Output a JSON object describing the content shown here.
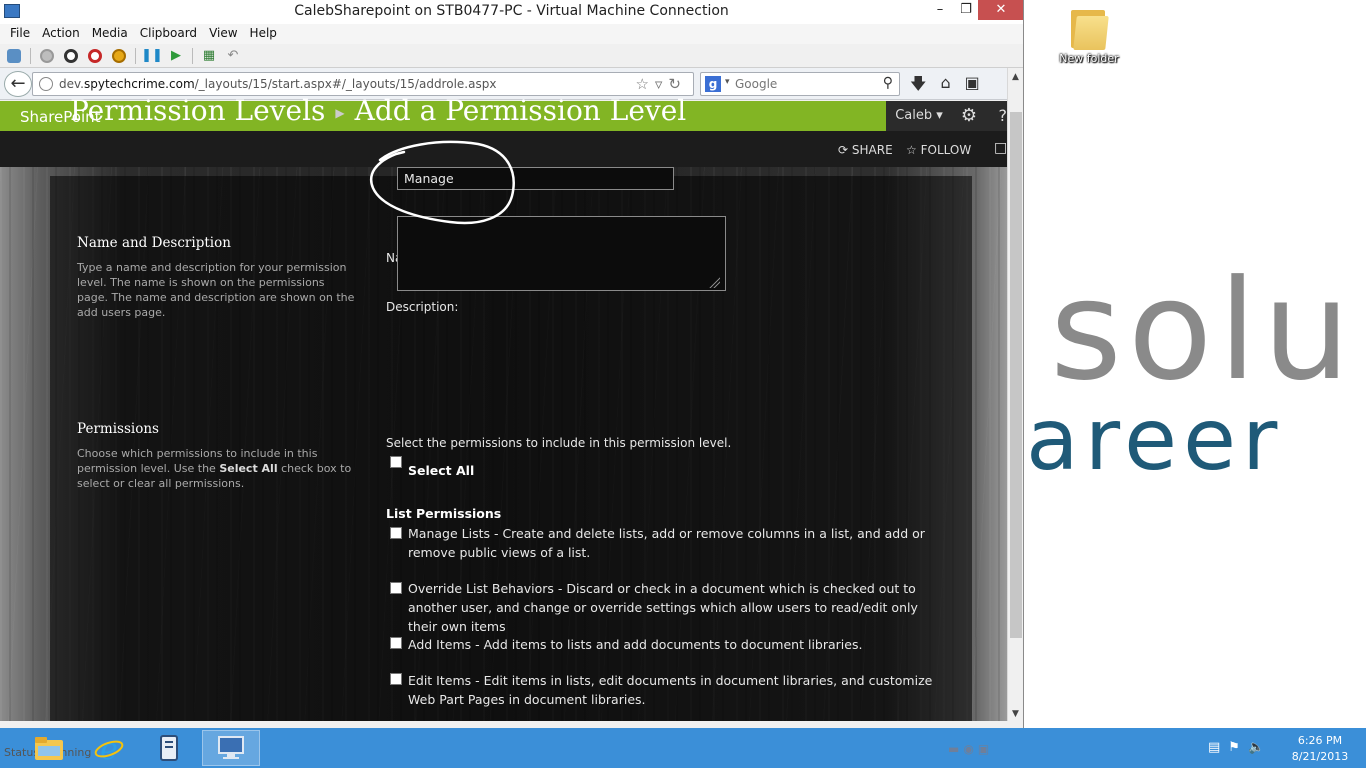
{
  "window": {
    "title": "CalebSharepoint on STB0477-PC - Virtual Machine Connection",
    "minimize": "–",
    "maximize": "❐",
    "close": "✕"
  },
  "menu": [
    "File",
    "Action",
    "Media",
    "Clipboard",
    "View",
    "Help"
  ],
  "toolbar_icons": [
    "ctrl-alt-del-icon",
    "start-icon",
    "turn-off-icon",
    "shutdown-icon",
    "power-icon",
    "pause-icon",
    "resume-icon",
    "checkpoint-icon",
    "revert-icon"
  ],
  "browser": {
    "url_prefix": "dev.",
    "url_domain": "spytechcrime.com",
    "url_path": "/_layouts/15/start.aspx#/_layouts/15/addrole.aspx",
    "search_placeholder": "Google"
  },
  "sharepoint": {
    "brand": "SharePoint",
    "user": "Caleb ▾",
    "share": "SHARE",
    "follow": "FOLLOW",
    "breadcrumb_parent": "Permission Levels",
    "breadcrumb_current": "Add a Permission Level",
    "name_section": {
      "heading": "Name and Description",
      "description": "Type a name and description for your permission level.  The name is shown on the permissions page.  The name and description are shown on the add users page.",
      "name_label": "Name:",
      "name_value": "Manage",
      "description_label": "Description:"
    },
    "permissions_section": {
      "heading": "Permissions",
      "desc_before": "Choose which permissions to include in this permission level.  Use the ",
      "desc_bold": "Select All",
      "desc_after": " check box to select or clear all permissions.",
      "intro": "Select the permissions to include in this permission level.",
      "select_all": "Select All",
      "list_heading": "List Permissions",
      "items": [
        "Manage Lists  -  Create and delete lists, add or remove columns in a list, and add or remove public views of a list.",
        "Override List Behaviors  -  Discard or check in a document which is checked out to another user, and change or override settings which allow users to read/edit only their own items",
        "Add Items  -  Add items to lists and add documents to document libraries.",
        "Edit Items  -  Edit items in lists, edit documents in document libraries, and customize Web Part Pages in document libraries."
      ]
    }
  },
  "desktop": {
    "icon_label": "New folder",
    "wallpaper_text_1": "solu",
    "wallpaper_text_2": "areer"
  },
  "taskbar": {
    "status": "Status: Running",
    "time": "6:26 PM",
    "date": "8/21/2013"
  },
  "colors": {
    "suite_bar": "#82b524",
    "taskbar": "#3b8fd8",
    "wallpaper_gray": "#8a8a8a",
    "wallpaper_blue": "#1f5a78"
  }
}
